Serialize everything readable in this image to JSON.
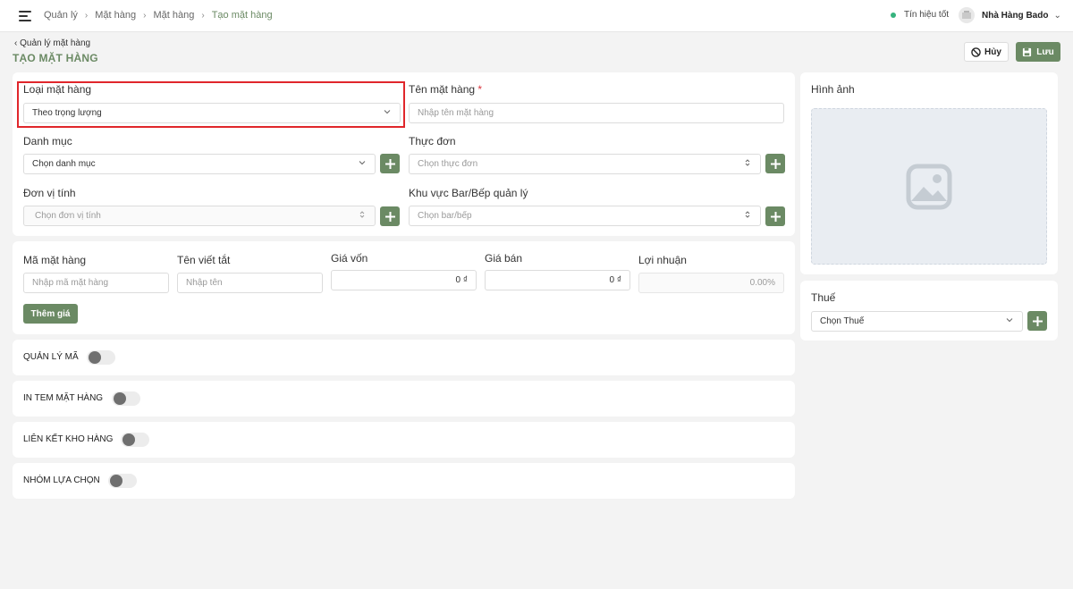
{
  "breadcrumb": [
    "Quản lý",
    "Mặt hàng",
    "Mặt hàng",
    "Tạo mặt hàng"
  ],
  "status": {
    "signal": "Tín hiệu tốt",
    "store": "Nhà Hàng Bado"
  },
  "header": {
    "back": "Quản lý mặt hàng",
    "title": "TẠO MẶT HÀNG",
    "cancel": "Hủy",
    "save": "Lưu"
  },
  "form": {
    "item_type": {
      "label": "Loại mặt hàng",
      "value": "Theo trọng lượng"
    },
    "item_name": {
      "label": "Tên mặt hàng",
      "required": "*",
      "placeholder": "Nhập tên mặt hàng"
    },
    "category": {
      "label": "Danh mục",
      "value": "Chọn danh mục"
    },
    "menu": {
      "label": "Thực đơn",
      "placeholder": "Chọn thực đơn"
    },
    "unit": {
      "label": "Đơn vị tính",
      "placeholder": "Chọn đơn vị tính"
    },
    "bar_area": {
      "label": "Khu vực Bar/Bếp quản lý",
      "placeholder": "Chọn bar/bếp"
    }
  },
  "pricing": {
    "code": {
      "label": "Mã mặt hàng",
      "placeholder": "Nhập mã mặt hàng"
    },
    "short_name": {
      "label": "Tên viết tắt",
      "placeholder": "Nhập tên"
    },
    "cost": {
      "label": "Giá vốn",
      "value": "0 ₫"
    },
    "price": {
      "label": "Giá bán",
      "value": "0 ₫"
    },
    "profit": {
      "label": "Lợi nhuận",
      "value": "0.00%"
    },
    "add_price": "Thêm giá"
  },
  "toggles": [
    {
      "label": "QUẢN LÝ MÃ",
      "on": false
    },
    {
      "label": "IN TEM MẶT HÀNG",
      "on": false
    },
    {
      "label": "LIÊN KẾT KHO HÀNG",
      "on": false
    },
    {
      "label": "NHÓM LỰA CHỌN",
      "on": false
    }
  ],
  "image": {
    "label": "Hình ảnh"
  },
  "tax": {
    "label": "Thuế",
    "value": "Chọn Thuế"
  },
  "colors": {
    "accent": "#6b8a64",
    "highlight": "#e0262b",
    "required": "#d9363e"
  },
  "icons": [
    "menu-icon",
    "chevron-right-icon",
    "chevron-left-icon",
    "ban-icon",
    "save-icon",
    "chevron-down-icon",
    "updown-icon",
    "plus-icon",
    "image-icon"
  ]
}
